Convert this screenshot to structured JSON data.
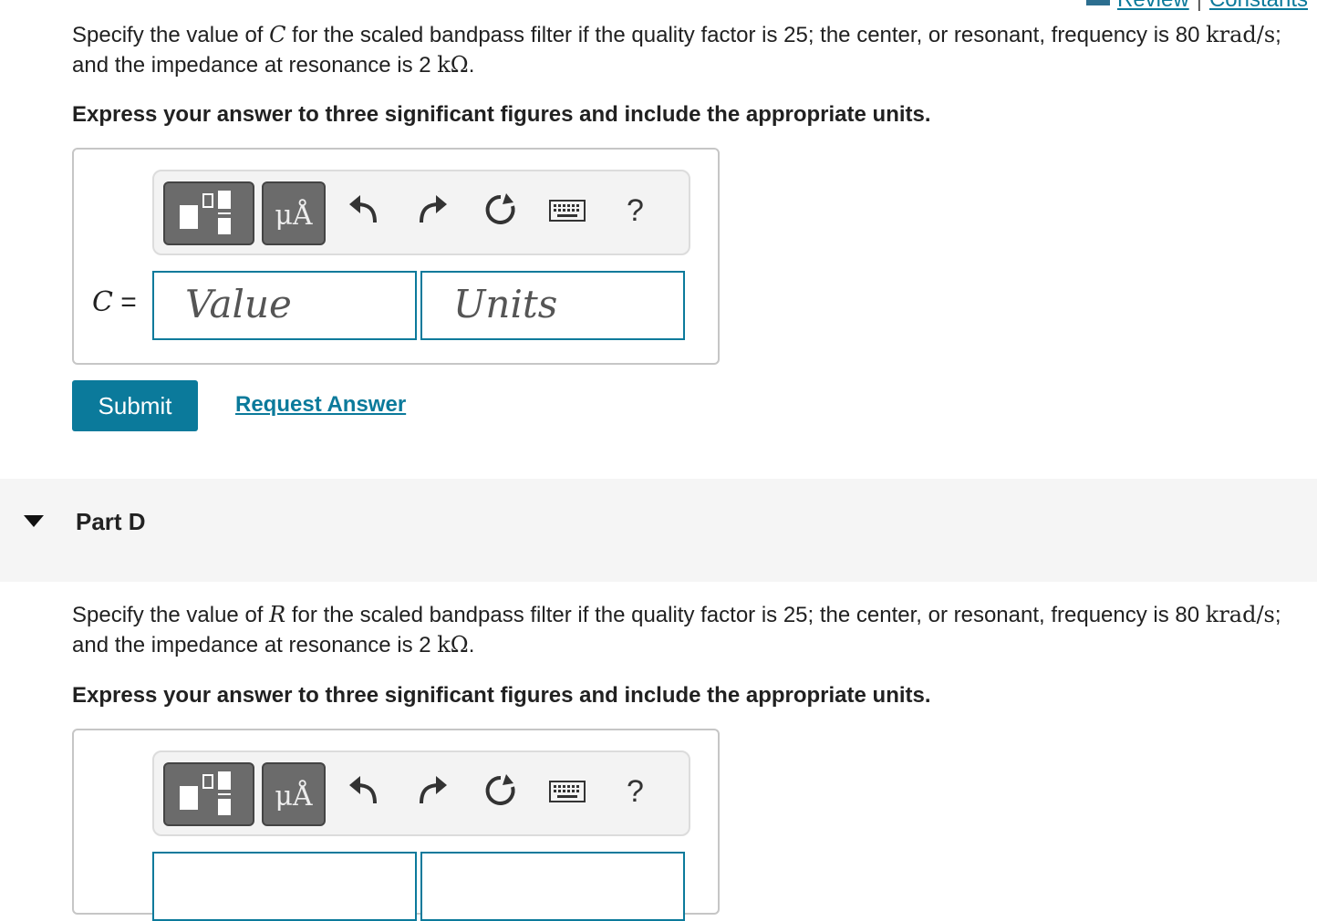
{
  "top_links": {
    "review": "Review",
    "separator": "|",
    "constants": "Constants"
  },
  "part_c": {
    "q_pre": "Specify the value of ",
    "q_var": "C",
    "q_mid": " for the scaled bandpass filter if the quality factor is 25; the center, or resonant, frequency is 80 ",
    "q_unit1": "krad/s",
    "q_mid2": "; and the impedance at resonance is 2 ",
    "q_unit2": "kΩ",
    "q_end": ".",
    "instruction": "Express your answer to three significant figures and include the appropriate units.",
    "var_label": "C",
    "eq": " =",
    "value_placeholder": "Value",
    "units_placeholder": "Units",
    "submit_label": "Submit",
    "request_label": "Request Answer"
  },
  "toolbar": {
    "units_symbol": "μÅ",
    "help_symbol": "?"
  },
  "part_d": {
    "title": "Part D",
    "q_pre": "Specify the value of ",
    "q_var": "R",
    "q_mid": " for the scaled bandpass filter if the quality factor is 25; the center, or resonant, frequency is 80 ",
    "q_unit1": "krad/s",
    "q_mid2": "; and the impedance at resonance is 2 ",
    "q_unit2": "kΩ",
    "q_end": ".",
    "instruction": "Express your answer to three significant figures and include the appropriate units."
  },
  "colors": {
    "accent": "#0b7a9b",
    "toolbar_button": "#6b6b6b",
    "part_bar": "#f5f5f5"
  }
}
